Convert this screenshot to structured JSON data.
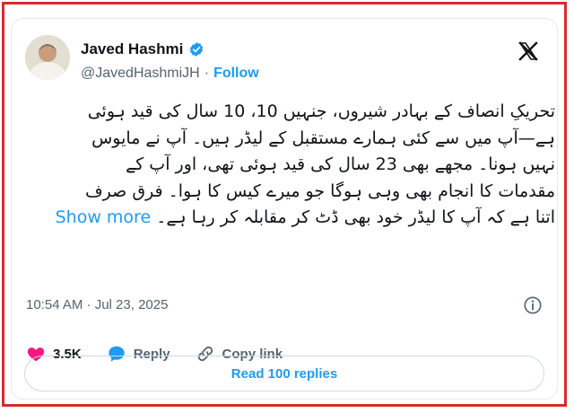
{
  "author": {
    "display_name": "Javed Hashmi",
    "handle": "@JavedHashmiJH",
    "separator": "·",
    "follow_label": "Follow",
    "verified_color": "#1d9bf0"
  },
  "tweet": {
    "lines": [
      "تحریکِ انصاف کے بہادر شیروں، جنہیں 10، 10 سال کی قید ہوئی",
      "ہے—آپ میں سے کئی ہمارے مستقبل کے لیڈر ہیں۔ آپ نے مایوس",
      "نہیں ہونا۔ مجھے بھی 23 سال کی قید ہوئی تھی، اور آپ کے",
      "مقدمات کا انجام بھی وہی ہوگا جو میرے کیس کا ہوا۔ فرق صرف"
    ],
    "last_line": "اتنا ہے کہ آپ کا لیڈر خود بھی ڈٹ کر مقابلہ کر رہا ہے۔",
    "show_more_label": "Show more"
  },
  "timestamp": "10:54 AM · Jul 23, 2025",
  "actions": {
    "like_count": "3.5K",
    "reply_label": "Reply",
    "copy_link_label": "Copy link"
  },
  "read_replies_label": "Read 100 replies",
  "colors": {
    "accent": "#1d9bf0",
    "like": "#f91880",
    "frame_border": "#d72c2c"
  },
  "icons": [
    "verified-badge-icon",
    "x-logo-icon",
    "info-icon",
    "heart-icon",
    "reply-bubble-icon",
    "link-icon"
  ]
}
